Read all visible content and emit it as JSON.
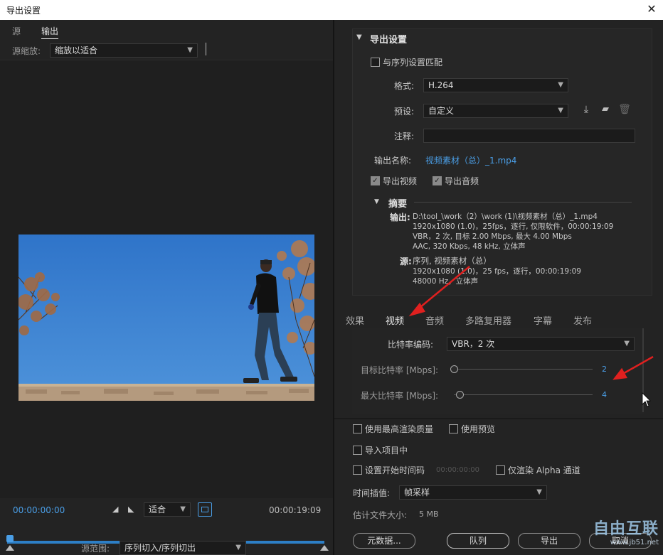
{
  "window": {
    "title": "导出设置",
    "close": "✕"
  },
  "left": {
    "tabs": [
      "源",
      "输出"
    ],
    "zoom_label": "源缩放:",
    "zoom_value": "缩放以适合",
    "timecode_start": "00:00:00:00",
    "timecode_end": "00:00:19:09",
    "fit_value": "适合",
    "range_label": "源范围:",
    "range_value": "序列切入/序列切出"
  },
  "export": {
    "section_title": "导出设置",
    "match_sequence": "与序列设置匹配",
    "format_label": "格式:",
    "format_value": "H.264",
    "preset_label": "预设:",
    "preset_value": "自定义",
    "comment_label": "注释:",
    "comment_value": "",
    "output_name_label": "输出名称:",
    "output_name_value": "视频素材（总）_1.mp4",
    "export_video": "导出视频",
    "export_audio": "导出音频",
    "summary_title": "摘要",
    "output_label": "输出:",
    "output_lines": [
      "D:\\tool_\\work（2）\\work (1)\\视频素材（总）_1.mp4",
      "1920x1080 (1.0)，25fps，逐行, 仅限软件，00:00:19:09",
      "VBR，2 次, 目标 2.00 Mbps, 最大 4.00 Mbps",
      "AAC, 320 Kbps, 48  kHz, 立体声"
    ],
    "source_label": "源:",
    "source_lines": [
      "序列, 视频素材（总）",
      "1920x1080 (1.0)，25 fps，逐行，00:00:19:09",
      "48000 Hz，立体声"
    ]
  },
  "subtabs": [
    "效果",
    "视频",
    "音频",
    "多路复用器",
    "字幕",
    "发布"
  ],
  "video": {
    "bitrate_encoding_label": "比特率编码:",
    "bitrate_encoding_value": "VBR，2 次",
    "target_label": "目标比特率 [Mbps]:",
    "target_value": "2",
    "max_label": "最大比特率 [Mbps]:",
    "max_value": "4",
    "target_level": 0.0,
    "max_level": 0.04
  },
  "bottom": {
    "max_render": "使用最高渲染质量",
    "use_preview": "使用预览",
    "import_project": "导入项目中",
    "set_start_tc": "设置开始时间码",
    "start_tc_value": "00:00:00:00",
    "alpha_only": "仅渲染 Alpha 通道",
    "interp_label": "时间插值:",
    "interp_value": "帧采样",
    "estimate_label": "估计文件大小:",
    "estimate_value": "5 MB",
    "metadata_button": "元数据...",
    "queue_button": "队列",
    "export_button": "导出",
    "cancel_button": "取消"
  },
  "watermark": {
    "text": "自由互联",
    "sub": "www.jb51.net"
  },
  "colors": {
    "accent": "#4a9ee6",
    "arrow": "#e0201f",
    "sky": "#2e76c8"
  }
}
